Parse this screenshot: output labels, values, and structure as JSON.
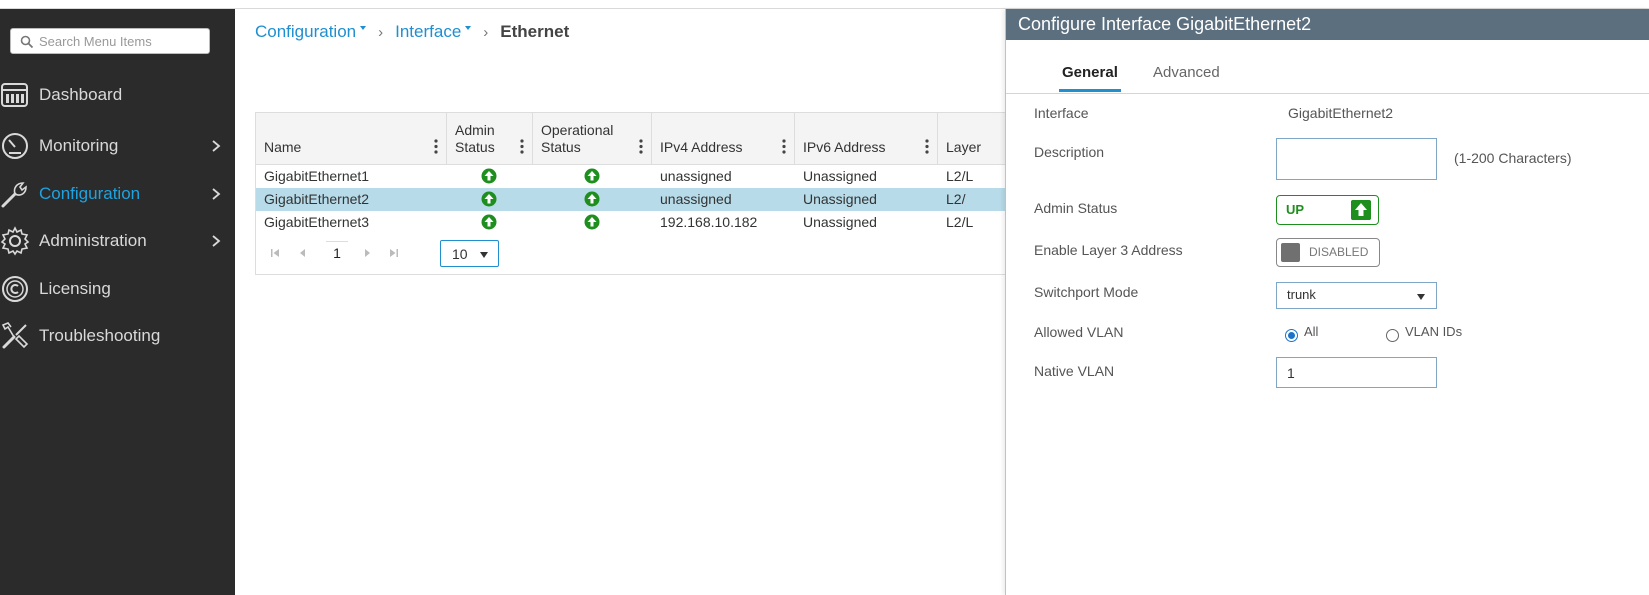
{
  "sidebar": {
    "search_placeholder": "Search Menu Items",
    "items": [
      {
        "label": "Dashboard",
        "icon": "dashboard-icon",
        "has_submenu": false,
        "active": false
      },
      {
        "label": "Monitoring",
        "icon": "gauge-icon",
        "has_submenu": true,
        "active": false
      },
      {
        "label": "Configuration",
        "icon": "wrench-icon",
        "has_submenu": true,
        "active": true
      },
      {
        "label": "Administration",
        "icon": "gear-icon",
        "has_submenu": true,
        "active": false
      },
      {
        "label": "Licensing",
        "icon": "license-icon",
        "has_submenu": false,
        "active": false
      },
      {
        "label": "Troubleshooting",
        "icon": "tools-icon",
        "has_submenu": false,
        "active": false
      }
    ]
  },
  "breadcrumb": {
    "level1": "Configuration",
    "level2": "Interface",
    "current": "Ethernet",
    "separator": "›"
  },
  "table": {
    "columns": [
      {
        "label": "Name"
      },
      {
        "label": "Admin Status"
      },
      {
        "label": "Operational Status"
      },
      {
        "label": "IPv4 Address"
      },
      {
        "label": "IPv6 Address"
      },
      {
        "label": "Layer"
      }
    ],
    "rows": [
      {
        "name": "GigabitEthernet1",
        "admin": "up",
        "oper": "up",
        "ipv4": "unassigned",
        "ipv6": "Unassigned",
        "layer": "L2/L",
        "selected": false
      },
      {
        "name": "GigabitEthernet2",
        "admin": "up",
        "oper": "up",
        "ipv4": "unassigned",
        "ipv6": "Unassigned",
        "layer": "L2/",
        "selected": true
      },
      {
        "name": "GigabitEthernet3",
        "admin": "up",
        "oper": "up",
        "ipv4": "192.168.10.182",
        "ipv6": "Unassigned",
        "layer": "L2/L",
        "selected": false
      }
    ],
    "pager": {
      "current_page": "1",
      "page_size": "10"
    }
  },
  "panel": {
    "title": "Configure Interface GigabitEthernet2",
    "tabs": [
      {
        "label": "General",
        "active": true
      },
      {
        "label": "Advanced",
        "active": false
      }
    ],
    "fields": {
      "interface_label": "Interface",
      "interface_value": "GigabitEthernet2",
      "description_label": "Description",
      "description_value": "",
      "description_hint": "(1-200 Characters)",
      "admin_status_label": "Admin Status",
      "admin_status_value": "UP",
      "layer3_label": "Enable Layer 3 Address",
      "layer3_value": "DISABLED",
      "switchport_label": "Switchport Mode",
      "switchport_value": "trunk",
      "allowed_vlan_label": "Allowed VLAN",
      "allowed_vlan_options": [
        "All",
        "VLAN IDs"
      ],
      "allowed_vlan_selected": "All",
      "native_vlan_label": "Native VLAN",
      "native_vlan_value": "1"
    }
  },
  "colors": {
    "sidebar_bg": "#2b2b2b",
    "accent_blue": "#1f8fd0",
    "status_green": "#1e8f1e",
    "panel_header": "#5b6f7f",
    "row_selected": "#b7dbe9"
  }
}
